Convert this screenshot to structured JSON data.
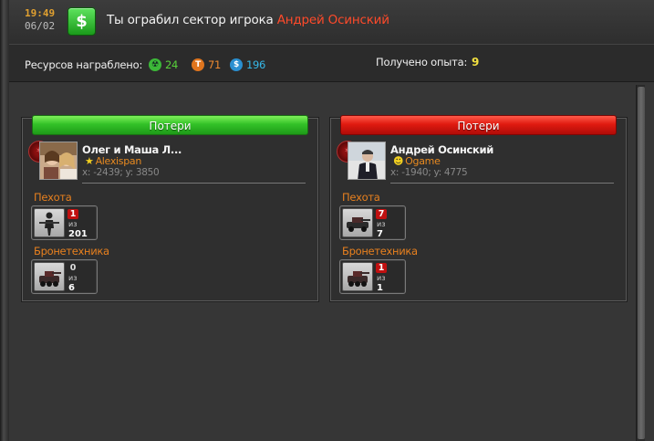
{
  "header": {
    "time": "19:49",
    "date": "06/02",
    "icon": "money-icon",
    "title_prefix": "Ты ограбил сектор игрока",
    "player": "Андрей Осинский"
  },
  "summary": {
    "label": "Ресурсов награблено:",
    "resources": [
      {
        "icon": "radiation-icon",
        "value": "24",
        "color": "#58d23a"
      },
      {
        "icon": "titanium-icon",
        "value": "71",
        "color": "#f08a30"
      },
      {
        "icon": "dollar-icon",
        "value": "196",
        "color": "#35b8e8"
      }
    ],
    "exp_label": "Получено опыта:",
    "exp_value": "9"
  },
  "panels": [
    {
      "loss_label": "Потери",
      "bar_color": "#33c228",
      "name": "Олег и Маша Л...",
      "alliance": "Alexispan",
      "coords": "x: -2439; y: 3850",
      "sections": [
        {
          "title": "Пехота",
          "unit_icon": "infantry-icon",
          "lost": "1",
          "of": "из",
          "total": "201"
        },
        {
          "title": "Бронетехника",
          "unit_icon": "armored-vehicle-icon",
          "lost": "0",
          "of": "из",
          "total": "6"
        }
      ]
    },
    {
      "loss_label": "Потери",
      "bar_color": "#e01a10",
      "name": "Андрей Осинский",
      "alliance": "Ogame",
      "coords": "x: -1940; y: 4775",
      "sections": [
        {
          "title": "Пехота",
          "unit_icon": "infantry-icon",
          "lost": "7",
          "of": "из",
          "total": "7"
        },
        {
          "title": "Бронетехника",
          "unit_icon": "armored-vehicle-icon",
          "lost": "1",
          "of": "из",
          "total": "1"
        }
      ]
    }
  ]
}
